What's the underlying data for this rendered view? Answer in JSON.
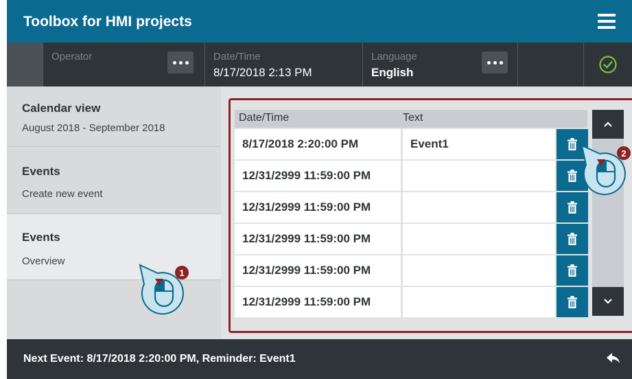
{
  "header": {
    "title": "Toolbox for HMI projects"
  },
  "infobar": {
    "operator_label": "Operator",
    "datetime_label": "Date/Time",
    "datetime_value": "8/17/2018 2:13 PM",
    "language_label": "Language",
    "language_value": "English"
  },
  "sidebar": {
    "items": [
      {
        "title": "Calendar view",
        "subtitle": "August 2018 - September 2018"
      },
      {
        "title": "Events",
        "subtitle": "Create new event"
      },
      {
        "title": "Events",
        "subtitle": "Overview"
      }
    ]
  },
  "table": {
    "columns": [
      "Date/Time",
      "Text"
    ],
    "rows": [
      {
        "datetime": "8/17/2018 2:20:00 PM",
        "text": "Event1"
      },
      {
        "datetime": "12/31/2999 11:59:00 PM",
        "text": ""
      },
      {
        "datetime": "12/31/2999 11:59:00 PM",
        "text": ""
      },
      {
        "datetime": "12/31/2999 11:59:00 PM",
        "text": ""
      },
      {
        "datetime": "12/31/2999 11:59:00 PM",
        "text": ""
      },
      {
        "datetime": "12/31/2999 11:59:00 PM",
        "text": ""
      }
    ]
  },
  "footer": {
    "text": "Next Event: 8/17/2018 2:20:00 PM,   Reminder: Event1"
  },
  "annotations": {
    "marker1": "1",
    "marker2": "2"
  },
  "icons": [
    "menu-icon",
    "more-icon",
    "check-circle-icon",
    "trash-icon",
    "chevron-up-icon",
    "chevron-down-icon",
    "back-arrow-icon",
    "mouse-cursor-icon"
  ],
  "colors": {
    "accent": "#0b6a8f",
    "dark": "#2f3439",
    "highlight_border": "#8a2322",
    "status_ok": "#7fbf3f",
    "marker": "#8a2322"
  }
}
